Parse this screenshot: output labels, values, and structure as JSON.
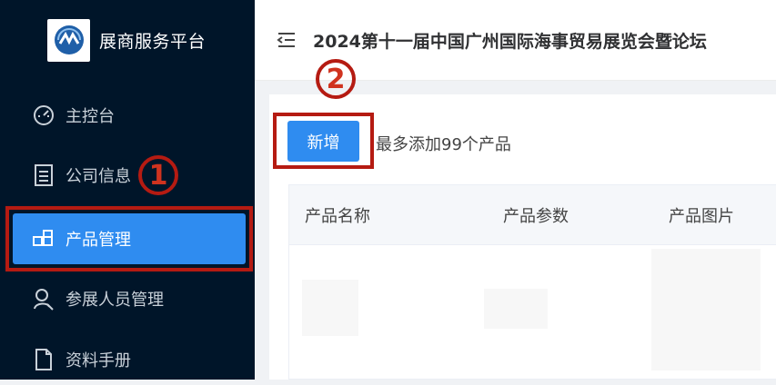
{
  "brand": {
    "name": "展商服务平台",
    "logo_icon": "brand-logo-icon"
  },
  "sidebar": {
    "items": [
      {
        "label": "主控台",
        "icon": "dashboard-gauge-icon"
      },
      {
        "label": "公司信息",
        "icon": "company-info-icon"
      },
      {
        "label": "产品管理",
        "icon": "product-blocks-icon",
        "active": true
      },
      {
        "label": "参展人员管理",
        "icon": "staff-icon"
      },
      {
        "label": "资料手册",
        "icon": "document-icon"
      }
    ]
  },
  "header": {
    "title": "2024第十一届中国广州国际海事贸易展览会暨论坛",
    "menu_icon": "menu-fold-icon"
  },
  "toolbar": {
    "add_label": "新增",
    "hint": "最多添加99个产品"
  },
  "table": {
    "columns": [
      "产品名称",
      "产品参数",
      "产品图片"
    ]
  },
  "annotations": {
    "step1": "1",
    "step2": "2"
  },
  "colors": {
    "sidebar_bg": "#001529",
    "accent": "#2f8cf0",
    "annotation": "#b51b12"
  }
}
